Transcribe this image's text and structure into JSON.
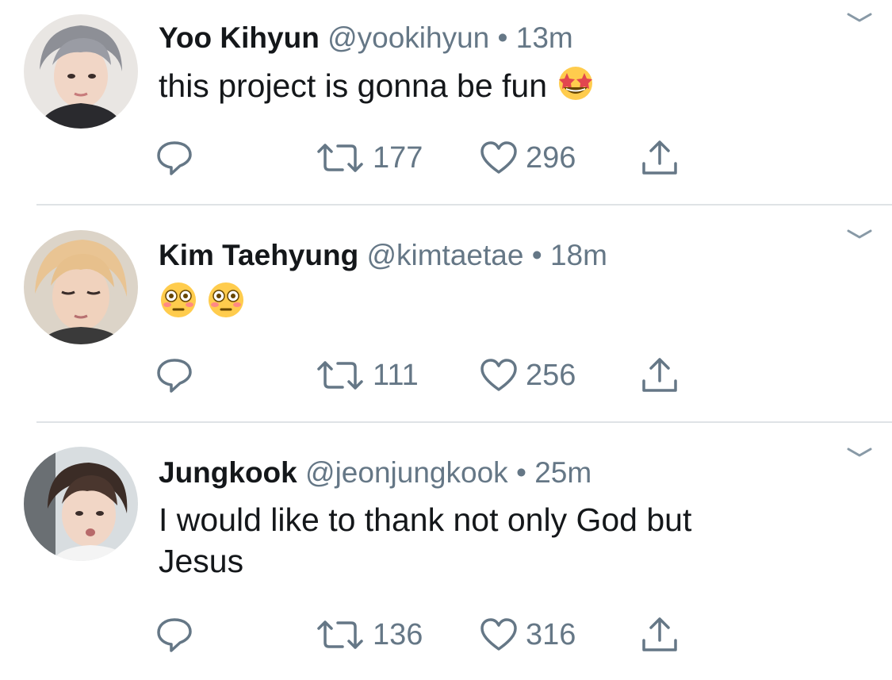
{
  "tweets": [
    {
      "name": "Yoo Kihyun",
      "handle": "@yookihyun",
      "separator": "•",
      "time": "13m",
      "text": "this project is gonna be fun",
      "emojis": [
        "star-struck-emoji"
      ],
      "retweets": "177",
      "likes": "296"
    },
    {
      "name": "Kim Taehyung",
      "handle": "@kimtaetae",
      "separator": "•",
      "time": "18m",
      "text": "",
      "emojis": [
        "flushed-face-emoji",
        "flushed-face-emoji"
      ],
      "retweets": "111",
      "likes": "256"
    },
    {
      "name": "Jungkook",
      "handle": "@jeonjungkook",
      "separator": "•",
      "time": "25m",
      "text_line1": "I would like to thank not only God but",
      "text_line2": "Jesus",
      "emojis": [],
      "retweets": "136",
      "likes": "316"
    }
  ],
  "colors": {
    "text": "#14171a",
    "secondary": "#657786",
    "divider": "#dfe3e6",
    "background": "#ffffff"
  },
  "icons": [
    "reply-icon",
    "retweet-icon",
    "like-icon",
    "share-icon",
    "chevron-down-icon"
  ]
}
